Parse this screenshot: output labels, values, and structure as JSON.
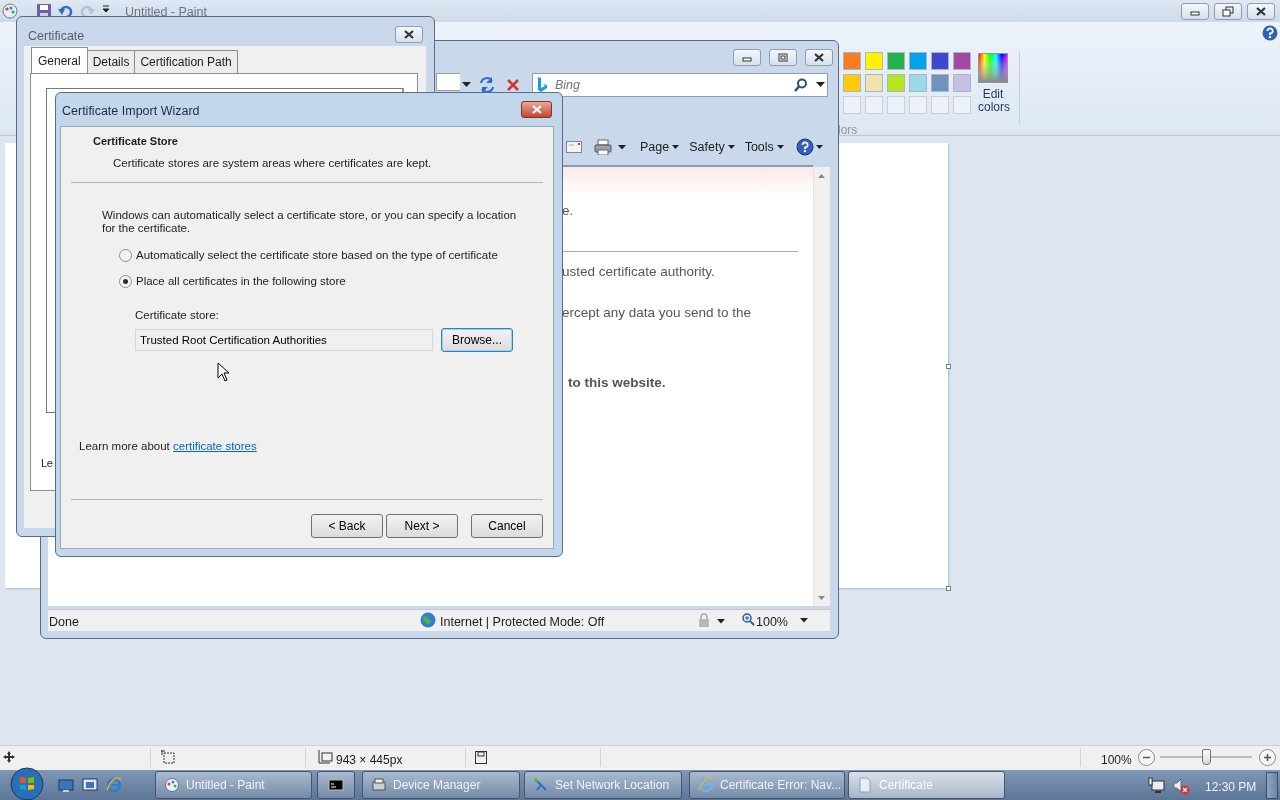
{
  "paint": {
    "title": "Untitled - Paint",
    "palette": [
      {
        "color": "#f57f20"
      },
      {
        "color": "#fff200"
      },
      {
        "color": "#22b14c"
      },
      {
        "color": "#00a2e8"
      },
      {
        "color": "#3f48cc"
      },
      {
        "color": "#a349a4"
      },
      {
        "color": "#ffc90e"
      },
      {
        "color": "#efe4b0"
      },
      {
        "color": "#b5e61d"
      },
      {
        "color": "#99d9ea"
      },
      {
        "color": "#7092be"
      },
      {
        "color": "#c8bfe7"
      }
    ],
    "edit_colors": "Edit colors",
    "group_label": "lors",
    "status": {
      "size": "943 × 445px",
      "zoom": "100%",
      "zoom_slider": {
        "level": 0.5
      }
    }
  },
  "browser": {
    "search": {
      "placeholder": "Bing"
    },
    "menus": [
      "Page",
      "Safety",
      "Tools"
    ],
    "content": [
      {
        "kind": "text",
        "text": "e."
      },
      {
        "kind": "rule"
      },
      {
        "kind": "text",
        "text": "usted certificate authority."
      },
      {
        "kind": "text",
        "text": "ercept any data you send to the"
      },
      {
        "kind": "bold",
        "text": "to this website."
      }
    ],
    "status": {
      "text": "Done",
      "zone": "Internet | Protected Mode: Off",
      "zoom": "100%"
    }
  },
  "certificate": {
    "title": "Certificate",
    "tabs": [
      {
        "label": "General",
        "selected": true
      },
      {
        "label": "Details",
        "selected": false
      },
      {
        "label": "Certification Path",
        "selected": false
      }
    ],
    "fragment": "Le"
  },
  "wizard": {
    "title": "Certificate Import Wizard",
    "heading": "Certificate Store",
    "subtitle": "Certificate stores are system areas where certificates are kept.",
    "intro": "Windows can automatically select a certificate store, or you can specify a location for the certificate.",
    "options": [
      {
        "label": "Automatically select the certificate store based on the type of certificate",
        "selected": false
      },
      {
        "label": "Place all certificates in the following store",
        "selected": true
      }
    ],
    "store_label": "Certificate store:",
    "store_value": "Trusted Root Certification Authorities",
    "browse": "Browse...",
    "learn_more": {
      "text": "Learn more about",
      "link": "certificate stores"
    },
    "buttons": [
      "< Back",
      "Next >",
      "Cancel"
    ]
  },
  "taskbar": {
    "buttons": [
      {
        "kind": "app",
        "label": "Untitled - Paint",
        "selected": false
      },
      {
        "kind": "icon",
        "selected": false
      },
      {
        "kind": "app",
        "label": "Device Manager",
        "selected": false
      },
      {
        "kind": "app",
        "label": "Set Network Location",
        "selected": false
      },
      {
        "kind": "app",
        "label": "Certificate Error: Nav...",
        "selected": false
      },
      {
        "kind": "app",
        "label": "Certificate",
        "selected": true
      }
    ],
    "clock": "12:30 PM"
  }
}
